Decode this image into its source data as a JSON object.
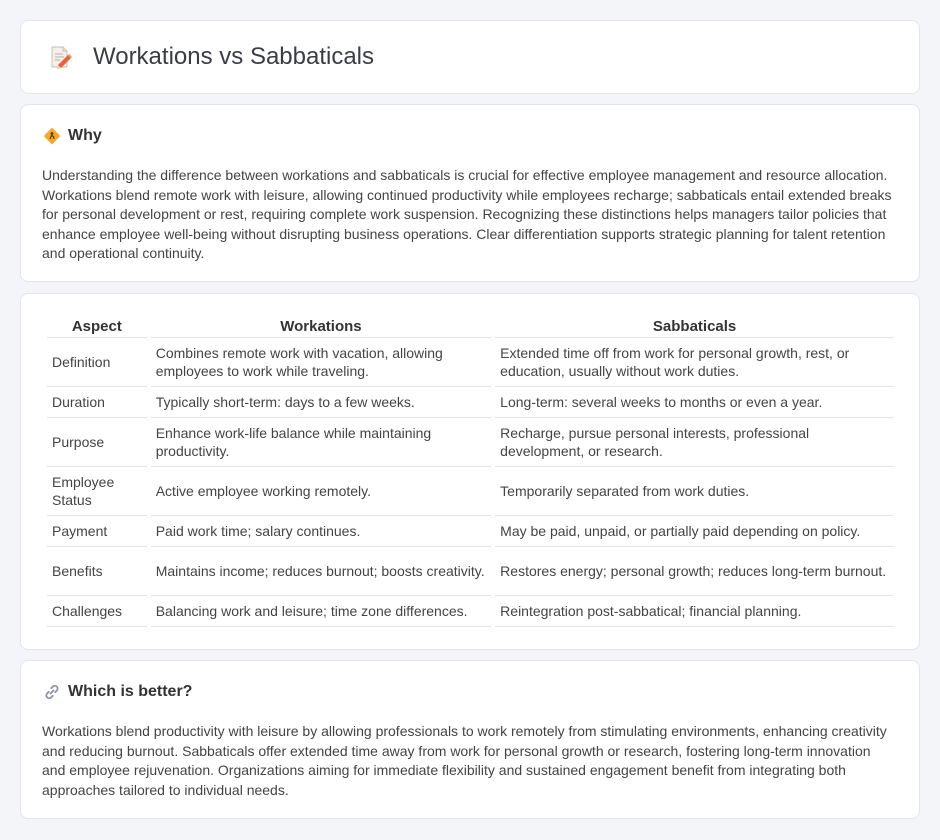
{
  "page": {
    "title": "Workations vs Sabbaticals",
    "icon": "document-pencil-icon"
  },
  "why": {
    "icon": "diamond-sign-icon",
    "heading": "Why",
    "text": "Understanding the difference between workations and sabbaticals is crucial for effective employee management and resource allocation. Workations blend remote work with leisure, allowing continued productivity while employees recharge; sabbaticals entail extended breaks for personal development or rest, requiring complete work suspension. Recognizing these distinctions helps managers tailor policies that enhance employee well-being without disrupting business operations. Clear differentiation supports strategic planning for talent retention and operational continuity."
  },
  "table": {
    "headers": [
      "Aspect",
      "Workations",
      "Sabbaticals"
    ],
    "rows": [
      [
        "Definition",
        "Combines remote work with vacation, allowing employees to work while traveling.",
        "Extended time off from work for personal growth, rest, or education, usually without work duties."
      ],
      [
        "Duration",
        "Typically short-term: days to a few weeks.",
        "Long-term: several weeks to months or even a year."
      ],
      [
        "Purpose",
        "Enhance work-life balance while maintaining productivity.",
        "Recharge, pursue personal interests, professional development, or research."
      ],
      [
        "Employee Status",
        "Active employee working remotely.",
        "Temporarily separated from work duties."
      ],
      [
        "Payment",
        "Paid work time; salary continues.",
        "May be paid, unpaid, or partially paid depending on policy."
      ],
      [
        "Benefits",
        "Maintains income; reduces burnout; boosts creativity.",
        "Restores energy; personal growth; reduces long-term burnout."
      ],
      [
        "Challenges",
        "Balancing work and leisure; time zone differences.",
        "Reintegration post-sabbatical; financial planning."
      ]
    ]
  },
  "better": {
    "icon": "link-icon",
    "heading": "Which is better?",
    "text": "Workations blend productivity with leisure by allowing professionals to work remotely from stimulating environments, enhancing creativity and reducing burnout. Sabbaticals offer extended time away from work for personal growth or research, fostering long-term innovation and employee rejuvenation. Organizations aiming for immediate flexibility and sustained engagement benefit from integrating both approaches tailored to individual needs."
  }
}
